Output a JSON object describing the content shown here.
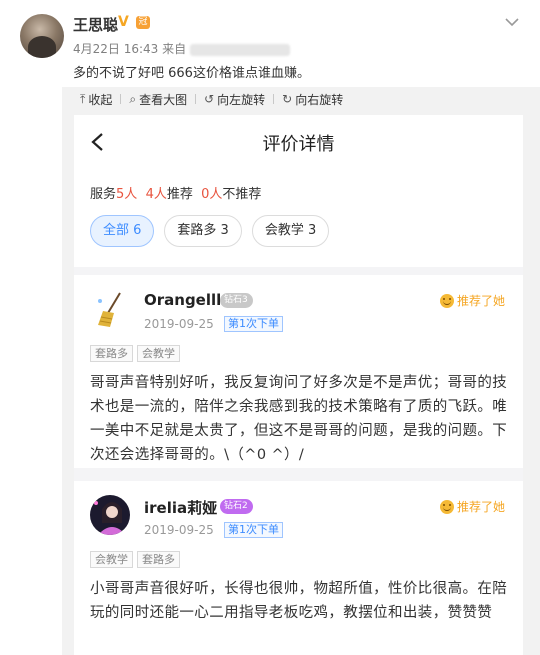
{
  "post": {
    "username": "王思聪",
    "v_badge": "V",
    "crown_badge": "冠",
    "meta": "4月22日 16:43 来自",
    "text": "多的不说了好吧 666这价格谁点谁血赚。"
  },
  "toolbar": {
    "collapse": "收起",
    "view_large": "查看大图",
    "rotate_left": "向左旋转",
    "rotate_right": "向右旋转"
  },
  "phone": {
    "title": "评价详情",
    "summary": {
      "served_label": "服务",
      "served_count": "5人",
      "recommend_count": "4人",
      "recommend_label": "推荐",
      "not_recommend_count": "0人",
      "not_recommend_label": "不推荐"
    },
    "tabs": [
      {
        "label": "全部 6"
      },
      {
        "label": "套路多 3"
      },
      {
        "label": "会教学 3"
      }
    ]
  },
  "reviews": [
    {
      "name": "Orangelll",
      "level": "钻石3",
      "recommend": "推荐了她",
      "date": "2019-09-25",
      "count_badge": "第1次下单",
      "tags": [
        "套路多",
        "会教学"
      ],
      "body": "哥哥声音特别好听，我反复询问了好多次是不是声优；哥哥的技术也是一流的，陪伴之余我感到我的技术策略有了质的飞跃。唯一美中不足就是太贵了，但这不是哥哥的问题，是我的问题。下次还会选择哥哥的。\\（^0 ^）/"
    },
    {
      "name": "irelia莉娅",
      "level": "钻石2",
      "recommend": "推荐了她",
      "date": "2019-09-25",
      "count_badge": "第1次下单",
      "tags": [
        "会教学",
        "套路多"
      ],
      "body": "小哥哥声音很好听，长得也很帅，物超所值，性价比很高。在陪玩的同时还能一心二用指导老板吃鸡，教摆位和出装，赞赞赞"
    }
  ],
  "colors": {
    "accent_blue": "#3d8cff",
    "recommend_orange": "#f5a623",
    "summary_red": "#e8543f",
    "level_gray": "#c8c8c8",
    "level_purple": "#c06bf0"
  }
}
